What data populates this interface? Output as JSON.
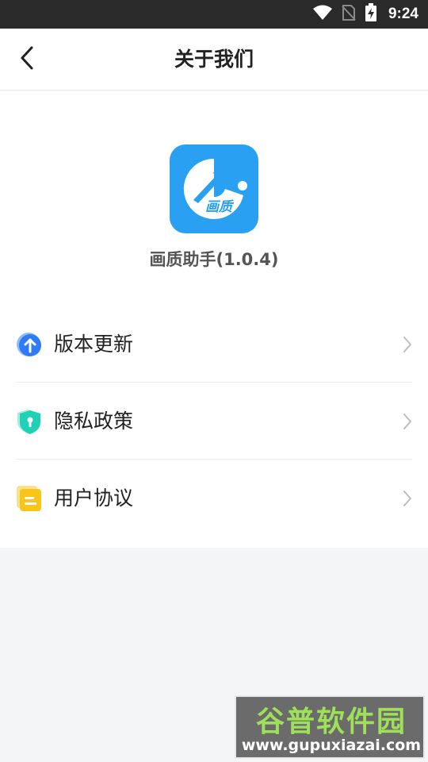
{
  "status_bar": {
    "time": "9:24",
    "icons": [
      "wifi-icon",
      "no-sim-icon",
      "battery-charging-icon"
    ]
  },
  "header": {
    "back_icon": "back-arrow-icon",
    "title": "关于我们"
  },
  "app": {
    "logo_icon": "app-logo-icon",
    "logo_text": "画质",
    "name": "画质助手(1.0.4)"
  },
  "menu": [
    {
      "label": "版本更新",
      "icon": "update-arrow-icon",
      "color": "#2f7bf5"
    },
    {
      "label": "隐私政策",
      "icon": "privacy-shield-icon",
      "color": "#1fd1b5"
    },
    {
      "label": "用户协议",
      "icon": "user-agreement-icon",
      "color": "#f8c51b"
    }
  ],
  "watermark": {
    "title": "谷普软件园",
    "url": "www.gupuxiazai.com"
  },
  "colors": {
    "brand": "#2aa0f3",
    "status_bar": "#2a2a2a",
    "background": "#f4f5f7"
  }
}
